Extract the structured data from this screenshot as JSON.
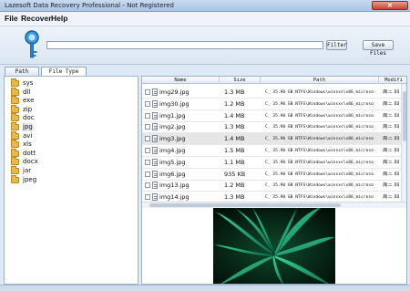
{
  "window": {
    "title": "Lazesoft Data Recovery Professional - Not Registered",
    "close_glyph": "×"
  },
  "menu": {
    "items": [
      "File",
      "Recover",
      "Help"
    ]
  },
  "search": {
    "value": "",
    "filter_label": "Filter",
    "save_label": "Save Files"
  },
  "tabs": [
    {
      "label": "Path"
    },
    {
      "label": "File Type"
    }
  ],
  "tree": {
    "items": [
      "sys",
      "dll",
      "exe",
      "zip",
      "doc",
      "jpg",
      "avi",
      "xls",
      "dott",
      "docx",
      "jar",
      "jpeg"
    ],
    "selected": "jpg"
  },
  "table": {
    "columns": [
      "Name",
      "Size",
      "Path",
      "Modifi"
    ],
    "rows": [
      {
        "name": "img29.jpg",
        "size": "1.3 MB",
        "path": "C_ 35.90 GB NTFS\\Windows\\winsxs\\x86_microso",
        "modified": "周三 四"
      },
      {
        "name": "img30.jpg",
        "size": "1.2 MB",
        "path": "C_ 35.90 GB NTFS\\Windows\\winsxs\\x86_microso",
        "modified": "周三 四"
      },
      {
        "name": "img1.jpg",
        "size": "1.4 MB",
        "path": "C_ 35.90 GB NTFS\\Windows\\winsxs\\x86_microso",
        "modified": "周三 四"
      },
      {
        "name": "img2.jpg",
        "size": "1.3 MB",
        "path": "C_ 35.90 GB NTFS\\Windows\\winsxs\\x86_microso",
        "modified": "周三 四"
      },
      {
        "name": "img3.jpg",
        "size": "1.4 MB",
        "path": "C_ 35.90 GB NTFS\\Windows\\winsxs\\x86_microso",
        "modified": "周三 四"
      },
      {
        "name": "img4.jpg",
        "size": "1.5 MB",
        "path": "C_ 35.90 GB NTFS\\Windows\\winsxs\\x86_microso",
        "modified": "周三 四"
      },
      {
        "name": "img5.jpg",
        "size": "1.1 MB",
        "path": "C_ 35.90 GB NTFS\\Windows\\winsxs\\x86_microso",
        "modified": "周三 四"
      },
      {
        "name": "img6.jpg",
        "size": "935 KB",
        "path": "C_ 35.90 GB NTFS\\Windows\\winsxs\\x86_microso",
        "modified": "周三 四"
      },
      {
        "name": "img13.jpg",
        "size": "1.2 MB",
        "path": "C_ 35.90 GB NTFS\\Windows\\winsxs\\x86_microso",
        "modified": "周三 四"
      },
      {
        "name": "img14.jpg",
        "size": "1.3 MB",
        "path": "C_ 35.90 GB NTFS\\Windows\\winsxs\\x86_microso",
        "modified": "周三 四"
      }
    ],
    "selected_row": 4
  },
  "colors": {
    "titlebar": "#a9c4e6",
    "accent": "#2a8fd6",
    "folder": "#e8b84a",
    "selection": "#e6e6e6",
    "preview_leaf": "#1aa37a"
  },
  "icons": {
    "app": "magnifier-key-icon",
    "tree": "folder-icon",
    "row": "file-icon"
  }
}
